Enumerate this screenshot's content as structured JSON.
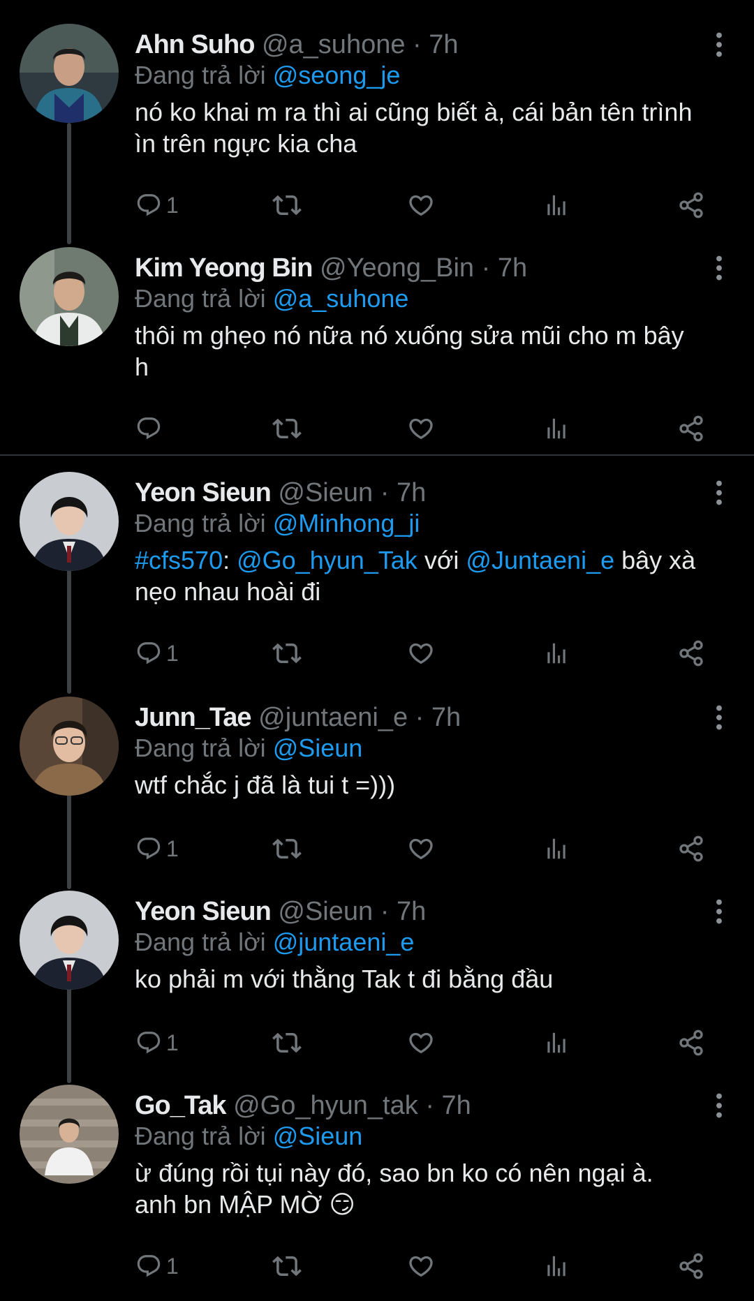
{
  "tweets": [
    {
      "name": "Ahn Suho",
      "handle": "@a_suhone",
      "time": "7h",
      "reply_label": "Đang trả lời",
      "reply_to": "@seong_je",
      "text_line1": "nó ko khai m ra thì ai cũng biết à, cái bản tên trình",
      "text_line2": "ìn trên ngực kia cha",
      "reply_count": "1"
    },
    {
      "name": "Kim Yeong Bin",
      "handle": "@Yeong_Bin",
      "time": "7h",
      "reply_label": "Đang trả lời",
      "reply_to": "@a_suhone",
      "text_line1": "thôi m ghẹo nó nữa nó xuống sửa mũi cho m bây",
      "text_line2": "h",
      "reply_count": ""
    },
    {
      "name": "Yeon Sieun",
      "handle": "@Sieun",
      "time": "7h",
      "reply_label": "Đang trả lời",
      "reply_to": "@Minhong_ji",
      "hashtag": "#cfs570",
      "colon": ": ",
      "mention1": "@Go_hyun_Tak",
      "with": " với ",
      "mention2": "@Juntaeni_e",
      "rest1": " bây xà",
      "text_line2": "nẹo nhau hoài đi",
      "reply_count": "1"
    },
    {
      "name": "Junn_Tae",
      "handle": "@juntaeni_e",
      "time": "7h",
      "reply_label": "Đang trả lời",
      "reply_to": "@Sieun",
      "text_line1": "wtf chắc j đã là tui t =)))",
      "reply_count": "1"
    },
    {
      "name": "Yeon Sieun",
      "handle": "@Sieun",
      "time": "7h",
      "reply_label": "Đang trả lời",
      "reply_to": "@juntaeni_e",
      "text_line1": "ko phải m với thằng Tak t đi bằng đầu",
      "reply_count": "1"
    },
    {
      "name": "Go_Tak",
      "handle": "@Go_hyun_tak",
      "time": "7h",
      "reply_label": "Đang trả lời",
      "reply_to": "@Sieun",
      "text_line1": "ừ đúng rồi tụi này đó, sao bn ko có nên ngại à.",
      "text_line2": "anh bn MẬP MỜ 😏",
      "reply_count": "1"
    }
  ],
  "separator": "·",
  "icons": {
    "reply": "reply-icon",
    "retweet": "retweet-icon",
    "like": "heart-icon",
    "views": "views-icon",
    "share": "share-icon",
    "more": "more-vertical-icon"
  },
  "colors": {
    "background": "#000000",
    "text": "#e7e9ea",
    "muted": "#71767b",
    "link": "#1d9bf0",
    "thread_line": "#3e4144"
  }
}
